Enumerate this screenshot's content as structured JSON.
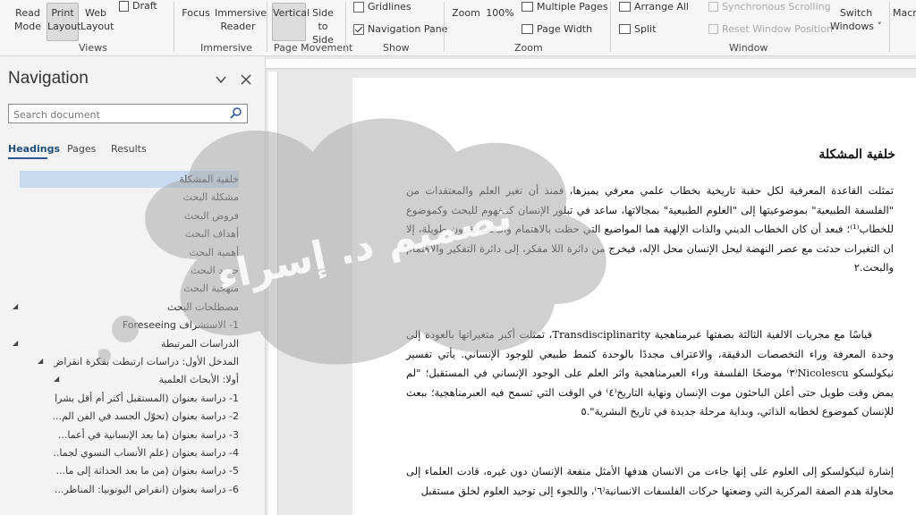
{
  "ribbon": {
    "views": {
      "read_mode": "Read\nMode",
      "print_layout": "Print\nLayout",
      "web_layout": "Web\nLayout",
      "draft": "Draft",
      "group": "Views"
    },
    "immersive": {
      "focus": "Focus",
      "immersive_reader": "Immersive\nReader",
      "group": "Immersive"
    },
    "page_movement": {
      "vertical": "Vertical",
      "side_to_side": "Side\nto Side",
      "group": "Page Movement"
    },
    "show": {
      "gridlines": "Gridlines",
      "navigation_pane": "Navigation Pane",
      "group": "Show"
    },
    "zoom": {
      "zoom": "Zoom",
      "hundred": "100%",
      "multiple_pages": "Multiple Pages",
      "page_width": "Page Width",
      "group": "Zoom"
    },
    "window": {
      "arrange_all": "Arrange All",
      "split": "Split",
      "sync_scrolling": "Synchronous Scrolling",
      "reset_position": "Reset Window Position",
      "switch_windows": "Switch\nWindows ˅",
      "group": "Window"
    },
    "macros": {
      "label": "Macr"
    }
  },
  "navigation": {
    "title": "Navigation",
    "search_placeholder": "Search document",
    "tabs": [
      "Headings",
      "Pages",
      "Results"
    ],
    "headings": [
      "خلفية المشكلة",
      "مشكلة البحث",
      "فروض البحث",
      "أهداف البحث",
      "أهمية البحث",
      "حدود البحث",
      "منهجية البحث",
      "مصطلحات البحث",
      "1- الاستشراف Foreseeing",
      "الدراسات المرتبطة",
      "المدخل الأول: دراسات ارتبطت بفكرة انقراض الإنس...",
      "أولا: الأبحاث العلمية",
      "1- دراسة بعنوان (المستقبل أكثر أم أقل بشرا...",
      "2- دراسة بعنوان (تحوّل الجسد في الفن الم...",
      "3- دراسة بعنوان (ما بعد الإنسانية في أعما...",
      "4- دراسة بعنوان (علم الأنساب النسوي لجما...",
      "5- دراسة بعنوان (من ما بعد الحداثة إلى ما...",
      "6- دراسة بعنوان (انقراض اليوتوبيا: المناظر..."
    ]
  },
  "document": {
    "heading": "خلفية المشكلة",
    "paragraphs": [
      "تمثلت القاعدة المعرفية لكل حقبة تاريخية بخطاب علمي معرفي يميزها، فمنذ أن تغير العلم والمعتقدات من \"الفلسفة الطبيعية\" بموضوعيتها إلى \"العلوم الطبيعية\" بمجالاتها، ساعد في تبلور الإنسان كمفهوم للبحث وكموضوع للخطاب⁽¹⁾؛ فبعد أن كان الخطاب الديني والذات الإلهية هما المواضيع التي حظت بالاهتمام والبحث لقرون طويلة، إلا ان التغيرات حدثت مع عصر النهضة ليحل الإنسان محل الإله، فيخرج من دائرة اللا مفكر، إلى دائرة التفكير والاهتمام والبحث.٢",
      "قياسًا مع مجريات الالفية الثالثة بصفتها عبرمناهجية Transdisciplinarity، تمثلت أكبر متغيراتها بالعودة إلى وحدة المعرفة وراء التخصصات الدقيقة، والاعتراف مجددًا بالوحدة كنمط طبيعي للوجود الإنساني. يأتي تفسير نيكولسكو Nicolescu⁽٣⁾ موضحًا الفلسفة وراء العبرمناهجية واثر العلم على الوجود الإنساني في المستقبل؛ \"لم يمض وقت طويل حتى أعلن الباحثون موت الإنسان ونهاية التاريخ⁽٤⁾ في الوقت التي تسمح فيه العبرمناهجية؛ ببعث للإنسان كموضوع لخطابه الذاتي، وبداية مرحلة جديدة في تاريخ البشرية\".٥",
      "إشارة لنيكولسكو إلى العلوم على إنها جاءت من الانسان هدفها الأمثل منفعة الإنسان دون غيره، قادت العلماء إلى محاولة هدم الصفة المركزية التي وضعتها حركات الفلسفات الانسانية⁽٦⁾، واللجوء إلى توحيد العلوم لخلق مستقبل"
    ],
    "watermark": "تصميم د. إسراء"
  },
  "colors": {
    "accent": "#2b579a",
    "selection": "#c7daf0",
    "watermark": "#a9a9a9"
  }
}
